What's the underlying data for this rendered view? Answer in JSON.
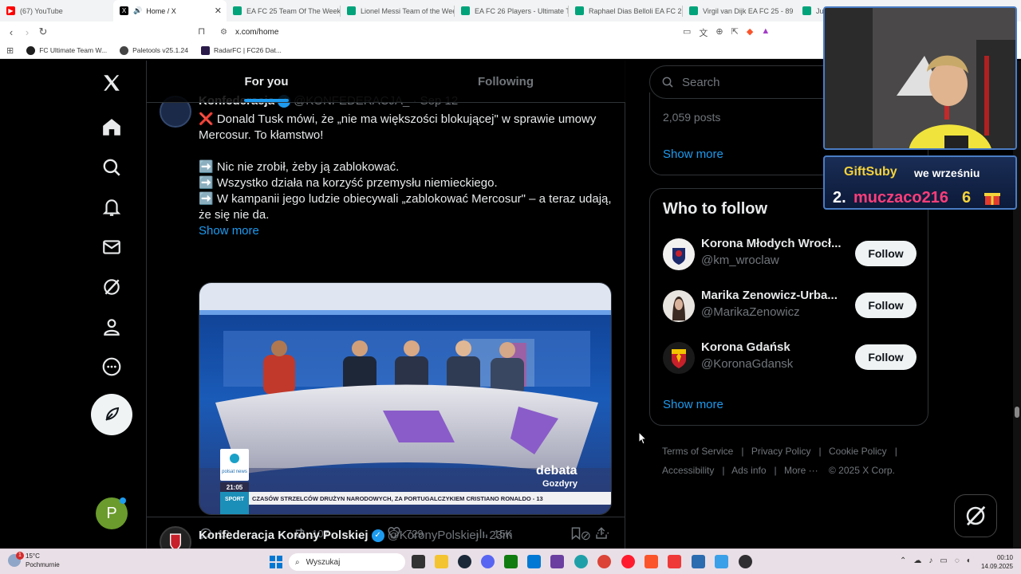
{
  "browser": {
    "tabs": [
      {
        "label": "(67) YouTube",
        "color": "#ff0000"
      },
      {
        "label": "Home / X",
        "color": "#000000",
        "active": true
      },
      {
        "label": "EA FC 25 Team Of The Week 1",
        "color": "#00a37a"
      },
      {
        "label": "Lionel Messi Team of the Week",
        "color": "#00a37a"
      },
      {
        "label": "EA FC 26 Players - Ultimate Te",
        "color": "#00a37a"
      },
      {
        "label": "Raphael Dias Belloli EA FC 26",
        "color": "#00a37a"
      },
      {
        "label": "Virgil van Dijk EA FC 25 - 89",
        "color": "#00a37a"
      },
      {
        "label": "Ju",
        "color": "#00a37a"
      }
    ],
    "url": "x.com/home",
    "bookmarks": [
      {
        "label": "FC Ultimate Team W...",
        "color": "#1e1e1e"
      },
      {
        "label": "Paletools v25.1.24",
        "color": "#444444"
      },
      {
        "label": "RadarFC | FC26 Dat...",
        "color": "#2a1a4a"
      }
    ]
  },
  "feed": {
    "tabs": [
      "For you",
      "Following"
    ],
    "tweet1": {
      "name": "Konfederacja",
      "handle": "@KONFEDERACJA_ · Sep 12",
      "lines": [
        "❌ Donald Tusk mówi, że „nie ma większości blokującej\" w sprawie umowy Mercosur. To kłamstwo!",
        "",
        "➡️ Nic nie zrobił, żeby ją zablokować.",
        "➡️ Wszystko działa na korzyść przemysłu niemieckiego.",
        "➡️ W kampanii jego ludzie obiecywali „zablokować Mercosur\" – a teraz udają, że się nie da."
      ],
      "show_more": "Show more",
      "media": {
        "logo": "polsat news",
        "time": "21:05",
        "sport": "SPORT",
        "ticker": "CZASÓW STRZELCÓW DRUŻYN NARODOWYCH, ZA PORTUGALCZYKIEM CRISTIANO RONALDO - 13",
        "program": "debata",
        "program_sub": "Gozdyry"
      },
      "replies": "10",
      "reposts": "107",
      "likes": "729",
      "views": "15K"
    },
    "tweet2": {
      "name": "Konfederacja Korony Polskiej",
      "handle": "@KoronyPolskiej · 23m"
    }
  },
  "sidebar": {
    "search_placeholder": "Search",
    "trend_posts": "2,059 posts",
    "show_more_1": "Show more",
    "who_to_follow_title": "Who to follow",
    "follow_suggestions": [
      {
        "name": "Korona Młodych Wrocł...",
        "handle": "@km_wroclaw",
        "button": "Follow"
      },
      {
        "name": "Marika Zenowicz-Urba...",
        "handle": "@MarikaZenowicz",
        "button": "Follow"
      },
      {
        "name": "Korona Gdańsk",
        "handle": "@KoronaGdansk",
        "button": "Follow"
      }
    ],
    "show_more_2": "Show more",
    "footer": [
      "Terms of Service",
      "Privacy Policy",
      "Cookie Policy",
      "Accessibility",
      "Ads info",
      "More ···",
      "© 2025 X Corp."
    ]
  },
  "overlay": {
    "gift_title": "GiftSuby",
    "gift_sub": "we wrześniu",
    "rank": "2.",
    "user": "muczaco216",
    "count": "6"
  },
  "taskbar": {
    "weather_temp": "15°C",
    "weather_desc": "Pochmurnie",
    "badge": "1",
    "search_placeholder": "Wyszukaj",
    "time": "00:10",
    "date": "14.09.2025"
  },
  "colors": {
    "accent": "#1d9bf0",
    "background": "#000000",
    "text": "#e7e9ea",
    "muted": "#71767b"
  }
}
